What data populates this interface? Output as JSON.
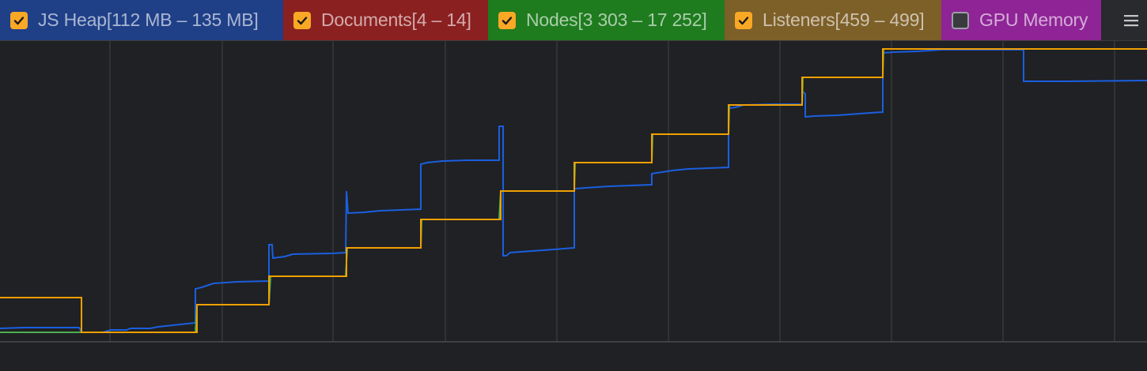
{
  "legend": {
    "items": [
      {
        "id": "js-heap",
        "label": "JS Heap[112 MB – 135 MB]",
        "checked": true,
        "bg": "#1f3f87"
      },
      {
        "id": "documents",
        "label": "Documents[4 – 14]",
        "checked": true,
        "bg": "#8b2020"
      },
      {
        "id": "nodes",
        "label": "Nodes[3 303 – 17 252]",
        "checked": true,
        "bg": "#1e7b1e"
      },
      {
        "id": "listeners",
        "label": "Listeners[459 – 499]",
        "checked": true,
        "bg": "#7d5f28"
      },
      {
        "id": "gpu-memory",
        "label": "GPU Memory",
        "checked": false,
        "bg": "#8e2496"
      }
    ],
    "menu_icon": "hamburger-menu-icon"
  },
  "colors": {
    "background": "#202124",
    "grid": "#3c3d40",
    "js_heap": "#1a5fe0",
    "documents": "#c62828",
    "nodes": "#4caf50",
    "listeners": "#f0a000",
    "checkbox": "#f9a825"
  },
  "chart_data": {
    "type": "line",
    "series": [
      {
        "name": "JS Heap",
        "color": "#1a5fe0"
      },
      {
        "name": "Nodes",
        "color": "#4caf50"
      },
      {
        "name": "Listeners",
        "color": "#f0a000"
      }
    ]
  }
}
